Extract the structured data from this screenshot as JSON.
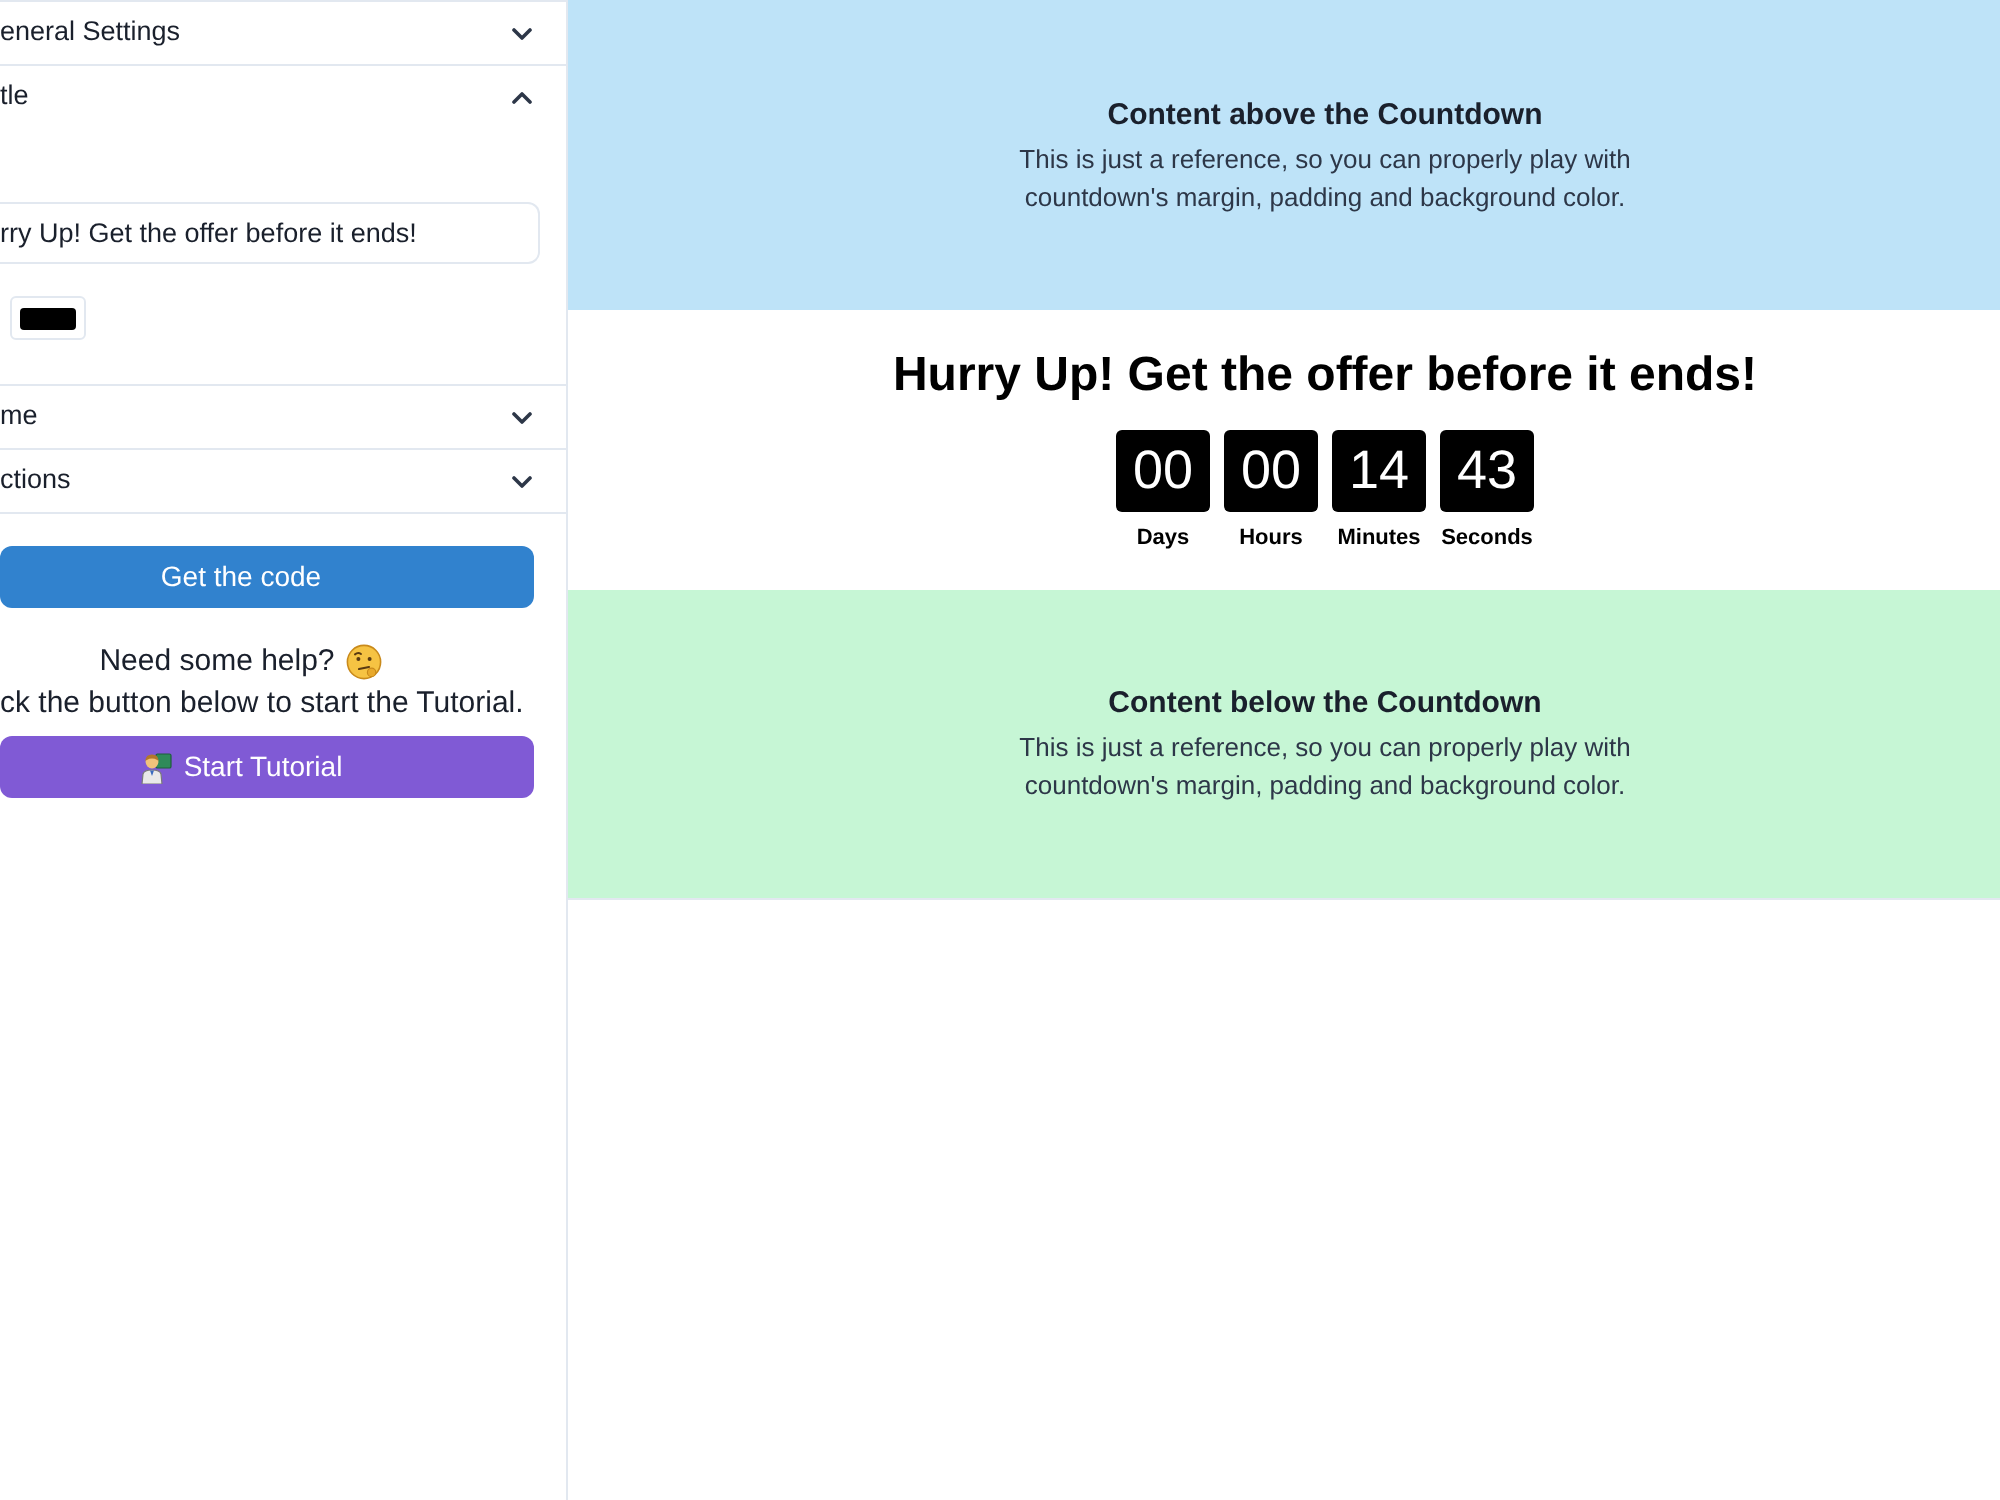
{
  "sidebar": {
    "sections": [
      {
        "title": "eneral Settings",
        "expanded": false
      },
      {
        "title": "tle",
        "expanded": true,
        "content": {
          "input_value": "rry Up! Get the offer before it ends!",
          "color": "#000000"
        }
      },
      {
        "title": "me",
        "expanded": false
      },
      {
        "title": "ctions",
        "expanded": false
      }
    ],
    "get_code_button": "Get the code",
    "help": {
      "title": "Need some help?",
      "text": "ck the button below to start the Tutorial.",
      "button": "Start Tutorial"
    }
  },
  "preview": {
    "above": {
      "heading": "Content above the Countdown",
      "text": "This is just a reference, so you can properly play with countdown's margin, padding and background color."
    },
    "countdown": {
      "title": "Hurry Up! Get the offer before it ends!",
      "units": [
        {
          "value": "00",
          "label": "Days"
        },
        {
          "value": "00",
          "label": "Hours"
        },
        {
          "value": "14",
          "label": "Minutes"
        },
        {
          "value": "43",
          "label": "Seconds"
        }
      ]
    },
    "below": {
      "heading": "Content below the Countdown",
      "text": "This is just a reference, so you can properly play with countdown's margin, padding and background color."
    }
  }
}
